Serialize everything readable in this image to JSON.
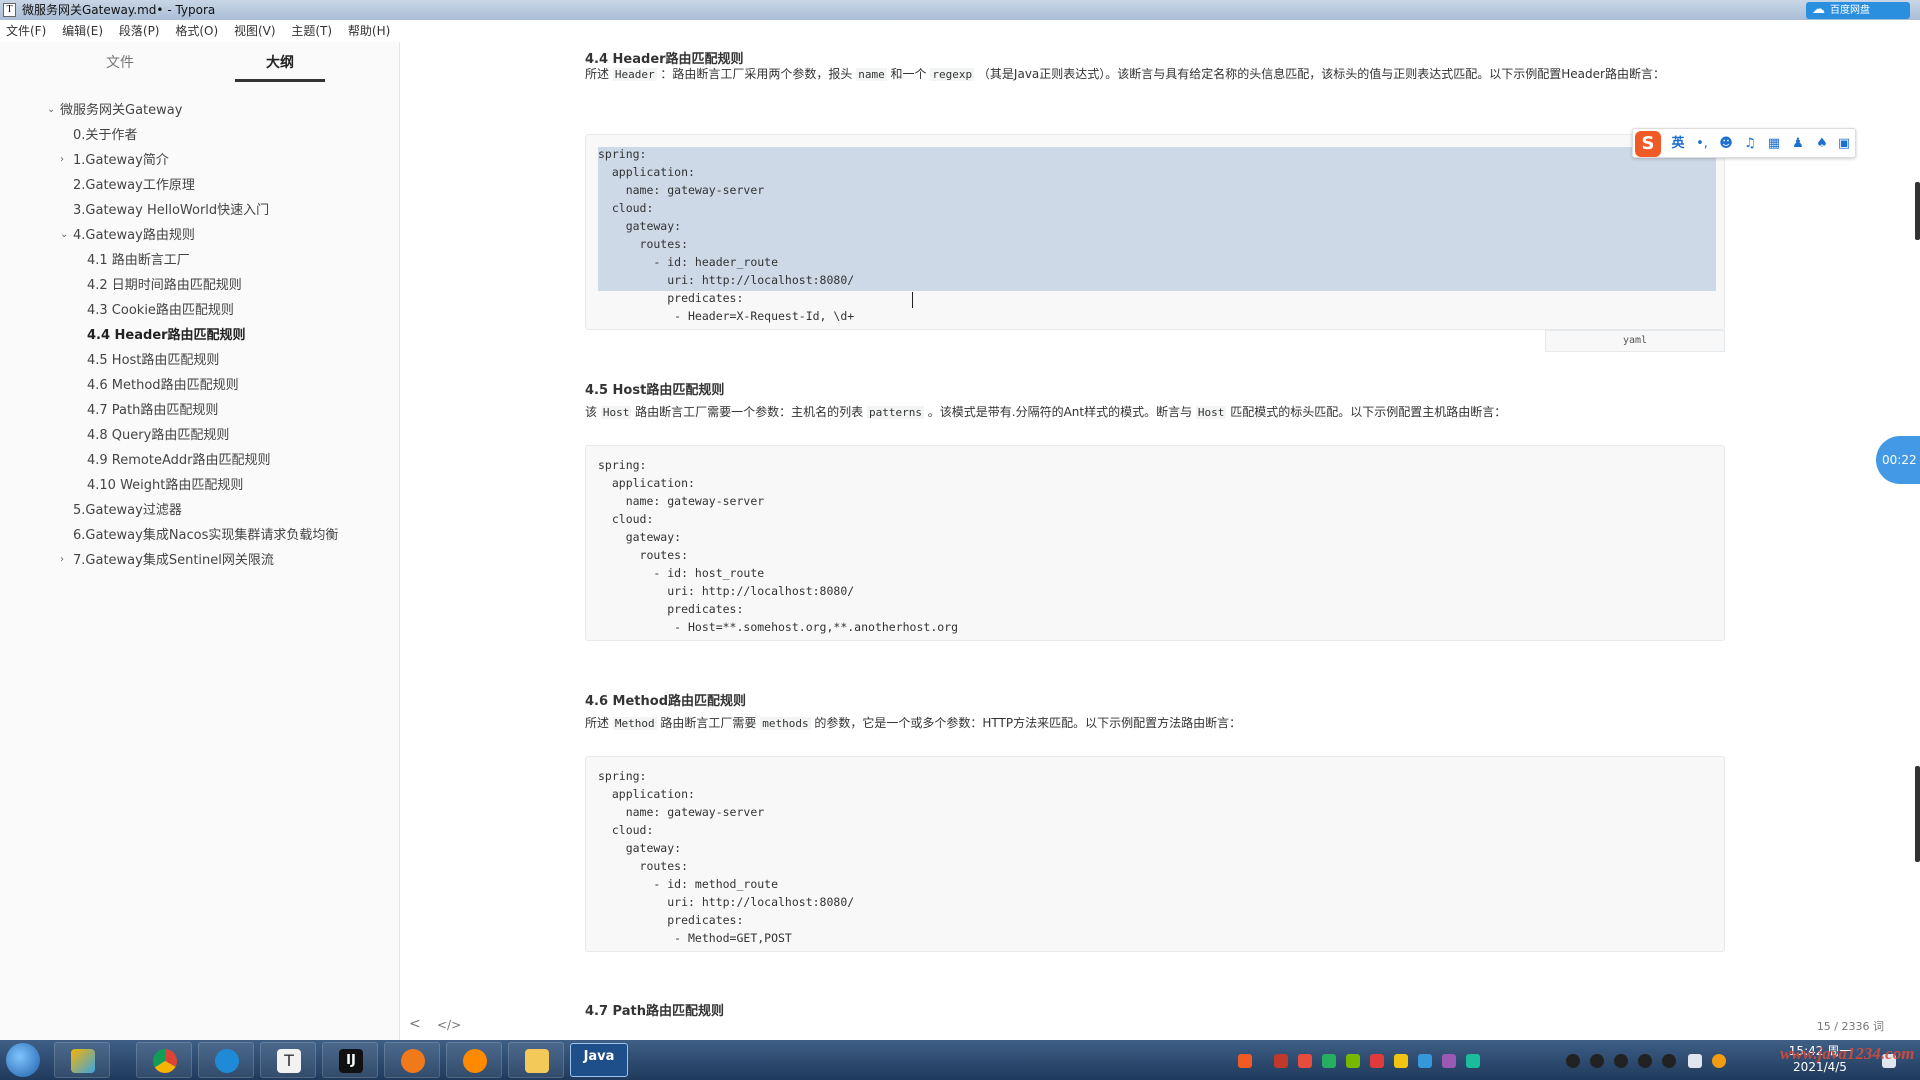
{
  "window": {
    "title": "微服务网关Gateway.md• - Typora",
    "cloud_label": "百度网盘"
  },
  "menu": [
    "文件(F)",
    "编辑(E)",
    "段落(P)",
    "格式(O)",
    "视图(V)",
    "主题(T)",
    "帮助(H)"
  ],
  "sidebar": {
    "tabs": [
      "文件",
      "大纲"
    ],
    "active_tab": "大纲",
    "outline": [
      {
        "label": "微服务网关Gateway",
        "level": 0,
        "caret": "v"
      },
      {
        "label": "0.关于作者",
        "level": 1,
        "caret": ""
      },
      {
        "label": "1.Gateway简介",
        "level": 1,
        "caret": ">"
      },
      {
        "label": "2.Gateway工作原理",
        "level": 1,
        "caret": ""
      },
      {
        "label": "3.Gateway HelloWorld快速入门",
        "level": 1,
        "caret": ""
      },
      {
        "label": "4.Gateway路由规则",
        "level": 1,
        "caret": "v"
      },
      {
        "label": "4.1 路由断言工厂",
        "level": 2,
        "caret": ""
      },
      {
        "label": "4.2 日期时间路由匹配规则",
        "level": 2,
        "caret": ""
      },
      {
        "label": "4.3 Cookie路由匹配规则",
        "level": 2,
        "caret": ""
      },
      {
        "label": "4.4 Header路由匹配规则",
        "level": 2,
        "caret": "",
        "active": true
      },
      {
        "label": "4.5 Host路由匹配规则",
        "level": 2,
        "caret": ""
      },
      {
        "label": "4.6 Method路由匹配规则",
        "level": 2,
        "caret": ""
      },
      {
        "label": "4.7 Path路由匹配规则",
        "level": 2,
        "caret": ""
      },
      {
        "label": "4.8 Query路由匹配规则",
        "level": 2,
        "caret": ""
      },
      {
        "label": "4.9 RemoteAddr路由匹配规则",
        "level": 2,
        "caret": ""
      },
      {
        "label": "4.10 Weight路由匹配规则",
        "level": 2,
        "caret": ""
      },
      {
        "label": "5.Gateway过滤器",
        "level": 1,
        "caret": ""
      },
      {
        "label": "6.Gateway集成Nacos实现集群请求负载均衡",
        "level": 1,
        "caret": ""
      },
      {
        "label": "7.Gateway集成Sentinel网关限流",
        "level": 1,
        "caret": ">"
      }
    ]
  },
  "document": {
    "s44": {
      "heading": "4.4 Header路由匹配规则",
      "para_parts": [
        "所述 ",
        "Header",
        " ：路由断言工厂采用两个参数，报头 ",
        "name",
        " 和一个 ",
        "regexp",
        " （其是Java正则表达式）。该断言与具有给定名称的头信息匹配，该标头的值与正则表达式匹配。以下示例配置Header路由断言："
      ],
      "code": [
        "spring:",
        "  application:",
        "    name: gateway-server",
        "  cloud:",
        "    gateway:",
        "      routes:",
        "        - id: header_route",
        "          uri: http://localhost:8080/",
        "          predicates:",
        "           - Header=X-Request-Id, \\d+"
      ],
      "lang": "yaml"
    },
    "s45": {
      "heading": "4.5 Host路由匹配规则",
      "para_parts": [
        "该 ",
        "Host",
        " 路由断言工厂需要一个参数：主机名的列表 ",
        "patterns",
        " 。该模式是带有.分隔符的Ant样式的模式。断言与 ",
        "Host",
        " 匹配模式的标头匹配。以下示例配置主机路由断言："
      ],
      "code": [
        "spring:",
        "  application:",
        "    name: gateway-server",
        "  cloud:",
        "    gateway:",
        "      routes:",
        "        - id: host_route",
        "          uri: http://localhost:8080/",
        "          predicates:",
        "           - Host=**.somehost.org,**.anotherhost.org"
      ]
    },
    "s46": {
      "heading": "4.6 Method路由匹配规则",
      "para_parts": [
        "所述 ",
        "Method",
        " 路由断言工厂需要 ",
        "methods",
        " 的参数，它是一个或多个参数：HTTP方法来匹配。以下示例配置方法路由断言："
      ],
      "code": [
        "spring:",
        "  application:",
        "    name: gateway-server",
        "  cloud:",
        "    gateway:",
        "      routes:",
        "        - id: method_route",
        "          uri: http://localhost:8080/",
        "          predicates:",
        "           - Method=GET,POST"
      ]
    },
    "s47": {
      "heading": "4.7 Path路由匹配规则"
    }
  },
  "ime": {
    "lang": "英",
    "punct": "•,"
  },
  "timer": "00:22",
  "footer": {
    "back": "<",
    "source": "</>",
    "word_count": "15 / 2336 词"
  },
  "taskbar": {
    "java_label": "Java",
    "time": "15:42 周一",
    "date": "2021/4/5"
  },
  "watermark": "www.java1234.com"
}
